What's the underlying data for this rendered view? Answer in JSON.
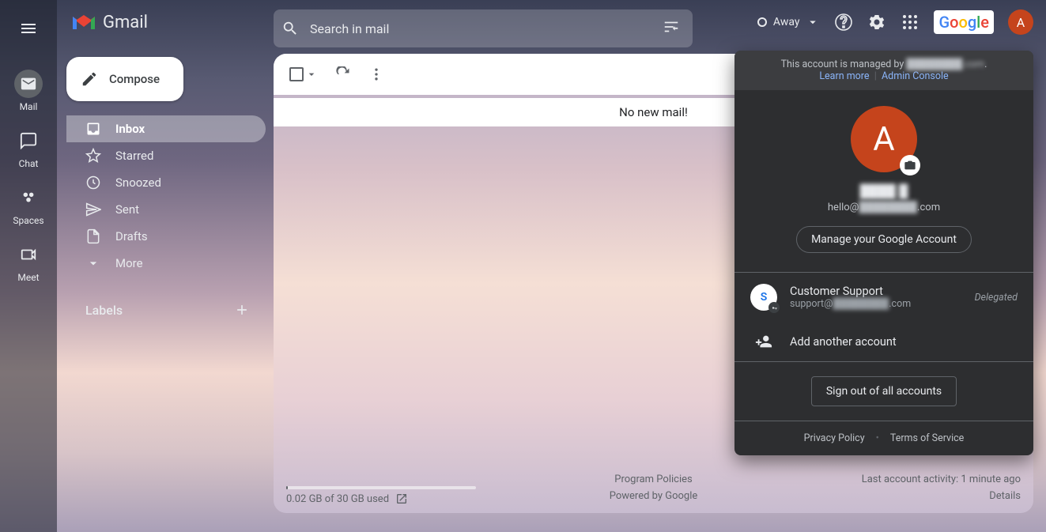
{
  "header": {
    "app_name": "Gmail",
    "search_placeholder": "Search in mail",
    "status_label": "Away",
    "google_logo_text": "Google",
    "avatar_initial": "A"
  },
  "rail": {
    "items": [
      {
        "label": "Mail"
      },
      {
        "label": "Chat"
      },
      {
        "label": "Spaces"
      },
      {
        "label": "Meet"
      }
    ]
  },
  "sidebar": {
    "compose_label": "Compose",
    "folders": [
      {
        "label": "Inbox"
      },
      {
        "label": "Starred"
      },
      {
        "label": "Snoozed"
      },
      {
        "label": "Sent"
      },
      {
        "label": "Drafts"
      },
      {
        "label": "More"
      }
    ],
    "labels_header": "Labels"
  },
  "main": {
    "empty_message": "No new mail!",
    "storage_text": "0.02 GB of 30 GB used",
    "footer_center_1": "Program Policies",
    "footer_center_2": "Powered by Google",
    "footer_right_1": "Last account activity: 1 minute ago",
    "footer_right_2": "Details"
  },
  "popover": {
    "banner_prefix": "This account is managed by ",
    "banner_domain": "████████.com",
    "banner_suffix": ".",
    "learn_more": "Learn more",
    "admin_console": "Admin Console",
    "avatar_initial": "A",
    "user_name": "████ █",
    "email_prefix": "hello@",
    "email_domain": "████████",
    "email_suffix": ".com",
    "manage_label": "Manage your Google Account",
    "delegated_account": {
      "avatar_initial": "S",
      "name": "Customer Support",
      "email_prefix": "support@",
      "email_domain": "████████",
      "email_suffix": ".com",
      "badge": "Delegated"
    },
    "add_account_label": "Add another account",
    "signout_label": "Sign out of all accounts",
    "privacy": "Privacy Policy",
    "terms": "Terms of Service"
  }
}
